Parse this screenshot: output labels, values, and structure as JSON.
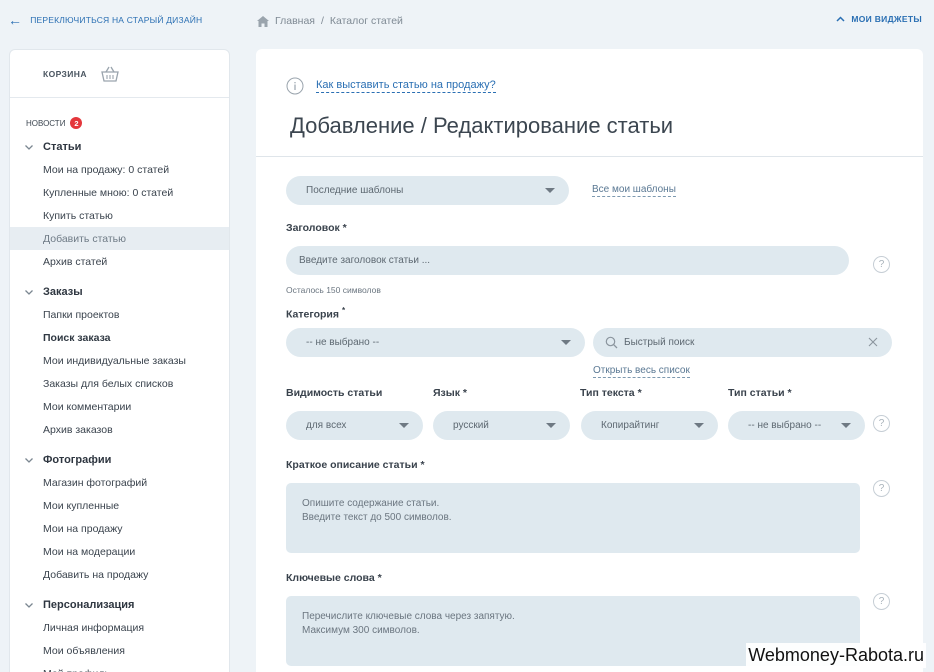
{
  "topbar": {
    "old_design": "ПЕРЕКЛЮЧИТЬСЯ НА СТАРЫЙ ДИЗАЙН",
    "breadcrumb": [
      "Главная",
      "/",
      "Каталог статей"
    ],
    "widgets": "МОИ ВИДЖЕТЫ"
  },
  "sidebar": {
    "cart": "КОРЗИНА",
    "news_label": "НОВОСТИ",
    "news_count": "2",
    "sections": [
      {
        "title": "Статьи",
        "items": [
          "Мои на продажу: 0 статей",
          "Купленные мною: 0 статей",
          "Купить статью",
          "Добавить статью",
          "Архив статей"
        ]
      },
      {
        "title": "Заказы",
        "items": [
          "Папки проектов",
          "Поиск заказа",
          "Мои индивидуальные заказы",
          "Заказы для белых списков",
          "Мои комментарии",
          "Архив заказов"
        ]
      },
      {
        "title": "Фотографии",
        "items": [
          "Магазин фотографий",
          "Мои купленные",
          "Мои на продажу",
          "Мои на модерации",
          "Добавить на продажу"
        ]
      },
      {
        "title": "Персонализация",
        "items": [
          "Личная информация",
          "Мои объявления",
          "Мой профиль"
        ]
      }
    ]
  },
  "main": {
    "help_link": "Как выставить статью на продажу?",
    "title": "Добавление / Редактирование статьи",
    "templates_select": "Последние шаблоны",
    "all_templates": "Все мои шаблоны",
    "headline_label": "Заголовок *",
    "headline_placeholder": "Введите заголовок статьи ...",
    "remaining": "Осталось 150 символов",
    "category_label": "Категория",
    "category_star": "*",
    "category_value": "-- не выбрано --",
    "quick_search_placeholder": "Быстрый поиск",
    "open_list": "Открыть весь список",
    "visibility_label": "Видимость статьи",
    "visibility_value": "для всех",
    "language_label": "Язык *",
    "language_value": "русский",
    "text_type_label": "Тип текста *",
    "text_type_value": "Копирайтинг",
    "article_type_label": "Тип статьи *",
    "article_type_value": "-- не выбрано --",
    "summary_label": "Краткое описание статьи *",
    "summary_placeholder_1": "Опишите содержание статьи.",
    "summary_placeholder_2": "Введите текст до 500 символов.",
    "keywords_label": "Ключевые слова *",
    "keywords_placeholder_1": "Перечислите ключевые слова через запятую.",
    "keywords_placeholder_2": "Максимум 300 символов.",
    "help_mark": "?"
  },
  "watermark": "Webmoney-Rabota.ru",
  "colors": {
    "accent": "#2a6fb3",
    "field_bg": "#dfe9ef",
    "page_bg": "#eef3f7",
    "badge": "#e4373c"
  }
}
